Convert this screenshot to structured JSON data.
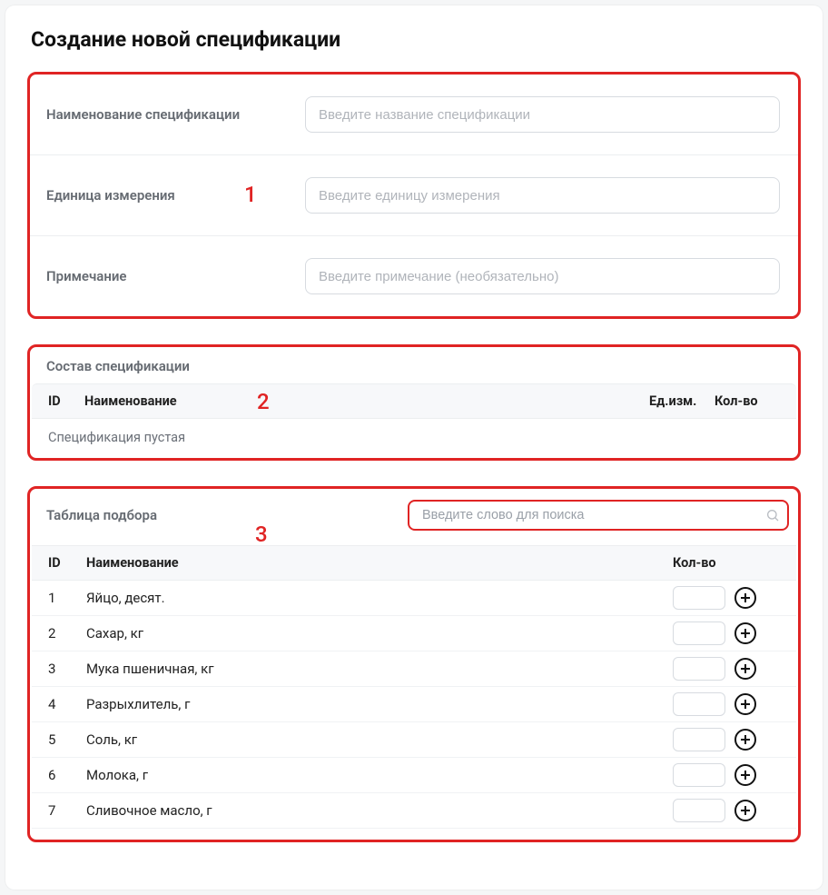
{
  "page": {
    "title": "Создание новой спецификации"
  },
  "callouts": {
    "one": "1",
    "two": "2",
    "three": "3"
  },
  "form": {
    "name_label": "Наименование спецификации",
    "name_placeholder": "Введите название спецификации",
    "unit_label": "Единица измерения",
    "unit_placeholder": "Введите единицу измерения",
    "note_label": "Примечание",
    "note_placeholder": "Введите примечание (необязательно)"
  },
  "composition": {
    "title": "Состав спецификации",
    "col_id": "ID",
    "col_name": "Наименование",
    "col_unit": "Ед.изм.",
    "col_qty": "Кол-во",
    "empty_msg": "Спецификация пустая"
  },
  "pick": {
    "title": "Таблица подбора",
    "search_placeholder": "Введите слово для поиска",
    "col_id": "ID",
    "col_name": "Наименование",
    "col_qty": "Кол-во",
    "rows": [
      {
        "id": "1",
        "name": "Яйцо, десят."
      },
      {
        "id": "2",
        "name": "Сахар, кг"
      },
      {
        "id": "3",
        "name": "Мука пшеничная, кг"
      },
      {
        "id": "4",
        "name": "Разрыхлитель, г"
      },
      {
        "id": "5",
        "name": "Соль, кг"
      },
      {
        "id": "6",
        "name": "Молока, г"
      },
      {
        "id": "7",
        "name": "Сливочное масло, г"
      }
    ]
  }
}
